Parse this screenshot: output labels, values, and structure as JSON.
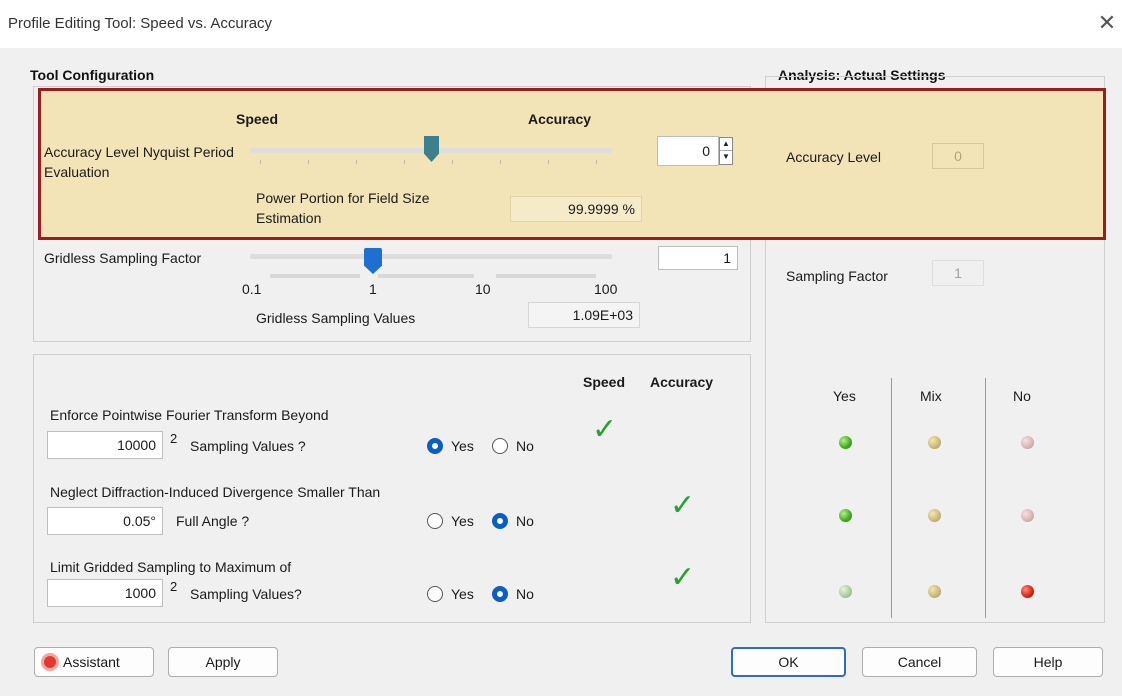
{
  "window": {
    "title": "Profile Editing Tool: Speed vs. Accuracy",
    "close_glyph": "✕"
  },
  "tool_config": {
    "title": "Tool Configuration",
    "speed_label": "Speed",
    "accuracy_label": "Accuracy",
    "accuracy_level_label": "Accuracy Level Nyquist Period Evaluation",
    "accuracy_level_value": "0",
    "accuracy_slider_fraction": 0.5,
    "power_portion_label": "Power Portion for Field Size Estimation",
    "power_portion_value": "99.9999 %",
    "gridless_label": "Gridless Sampling Factor",
    "gridless_value": "1",
    "gridless_ticks": [
      "0.1",
      "1",
      "10",
      "100"
    ],
    "gridless_values_label": "Gridless Sampling Values",
    "gridless_values_value": "1.09E+03"
  },
  "options": {
    "speed_header": "Speed",
    "accuracy_header": "Accuracy",
    "yes_label": "Yes",
    "no_label": "No",
    "superscript": "2",
    "rows": [
      {
        "title": "Enforce Pointwise Fourier Transform Beyond",
        "value": "10000",
        "suffix": "Sampling Values ?",
        "selected": "Yes",
        "check": "speed"
      },
      {
        "title": "Neglect Diffraction-Induced Divergence Smaller Than",
        "value": "0.05°",
        "suffix": "Full Angle ?",
        "selected": "No",
        "check": "accuracy"
      },
      {
        "title": "Limit Gridded Sampling to Maximum of",
        "value": "1000",
        "suffix": "Sampling Values?",
        "selected": "No",
        "check": "accuracy"
      }
    ]
  },
  "analysis": {
    "title": "Analysis: Actual Settings",
    "accuracy_level_label": "Accuracy Level",
    "accuracy_level_value": "0",
    "sampling_factor_label": "Sampling Factor",
    "sampling_factor_value": "1",
    "col_yes": "Yes",
    "col_mix": "Mix",
    "col_no": "No",
    "led_rows": [
      [
        "green",
        "tan",
        "pink"
      ],
      [
        "green",
        "tan",
        "pink"
      ],
      [
        "palegreen",
        "tan",
        "red"
      ]
    ]
  },
  "buttons": {
    "assistant": "Assistant",
    "apply": "Apply",
    "ok": "OK",
    "cancel": "Cancel",
    "help": "Help"
  },
  "colors": {
    "highlight": "#f3e4b7",
    "highlight_border": "#9b1d1d",
    "check": "#26a32e",
    "radio": "#0a5fc4"
  }
}
